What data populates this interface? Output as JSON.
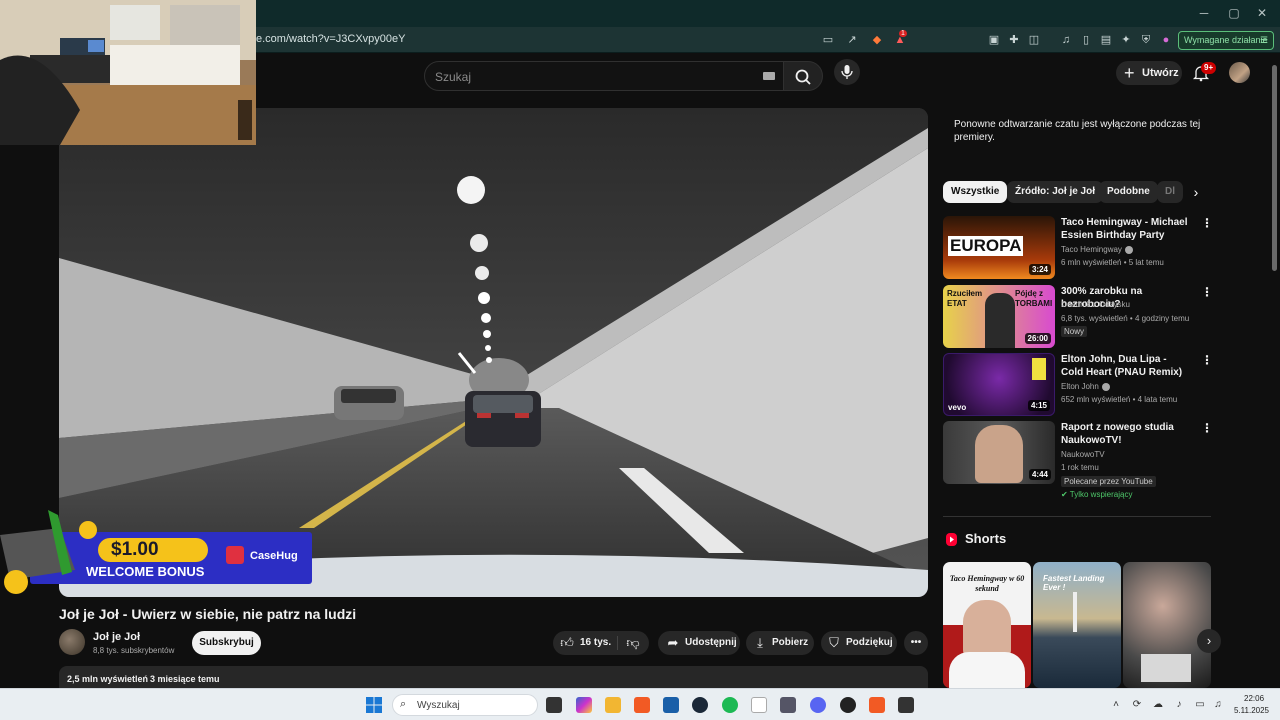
{
  "browser": {
    "url": "e.com/watch?v=J3CXvpy00eY",
    "action_button": "Wymagane działanie",
    "notif_badge": "1"
  },
  "youtube_header": {
    "search_placeholder": "Szukaj",
    "create_label": "Utwórz",
    "notifications_badge": "9+"
  },
  "video": {
    "title": "Joł je Joł - Uwierz w siebie, nie patrz na ludzi",
    "channel": "Joł je Joł",
    "subscribers": "8,8 tys. subskrybentów",
    "subscribe_label": "Subskrybuj",
    "likes": "16 tys.",
    "share_label": "Udostępnij",
    "download_label": "Pobierz",
    "thanks_label": "Podziękuj",
    "views": "2,5 mln wyświetleń",
    "date": "3 miesiące temu"
  },
  "ad_overlay": {
    "amount": "$1.00",
    "text": "WELCOME BONUS",
    "brand": "CaseHug"
  },
  "sidebar": {
    "chat_note": "Ponowne odtwarzanie czatu jest wyłączone podczas tej premiery.",
    "chips": [
      "Wszystkie",
      "Źródło: Joł je Joł",
      "Podobne",
      "Dl"
    ],
    "recommendations": [
      {
        "title": "Taco Hemingway - Michael Essien Birthday Party (prod. ...",
        "channel": "Taco Hemingway",
        "meta": "6 mln wyświetleń • 5 lat temu",
        "duration": "3:24",
        "thumb_text": "EUROPA"
      },
      {
        "title": "300% zarobku na bezrobociu?",
        "channel": "Osadnik z Odzysku",
        "meta": "6,8 tys. wyświetleń • 4 godziny temu",
        "badge": "Nowy",
        "duration": "26:00",
        "thumb_text_a": "Rzuciłem ETAT",
        "thumb_text_b": "Pójdę z TORBAMI"
      },
      {
        "title": "Elton John, Dua Lipa - Cold Heart (PNAU Remix) (Official ...",
        "channel": "Elton John",
        "meta": "652 mln wyświetleń • 4 lata temu",
        "duration": "4:15",
        "thumb_text": "vevo"
      },
      {
        "title": "Raport z nowego studia NaukowoTV!",
        "channel": "NaukowoTV",
        "meta": "1 rok temu",
        "badge": "Polecane przez YouTube",
        "badge2": "Tylko wspierający",
        "duration": "4:44"
      }
    ],
    "shorts_heading": "Shorts",
    "shorts": [
      {
        "text": "Taco Hemingway w 60 sekund"
      },
      {
        "text": "Fastest Landing Ever !"
      },
      {
        "text": ""
      }
    ]
  },
  "taskbar": {
    "search_placeholder": "Wyszukaj",
    "time": "22:06",
    "date": "5.11.2025"
  },
  "colors": {
    "yt_bg": "#0f0f0f",
    "pill_bg": "#272727",
    "browser_title": "#0f2a2a",
    "action_green": "#5bbf7a",
    "badge_red": "#cc0000"
  }
}
